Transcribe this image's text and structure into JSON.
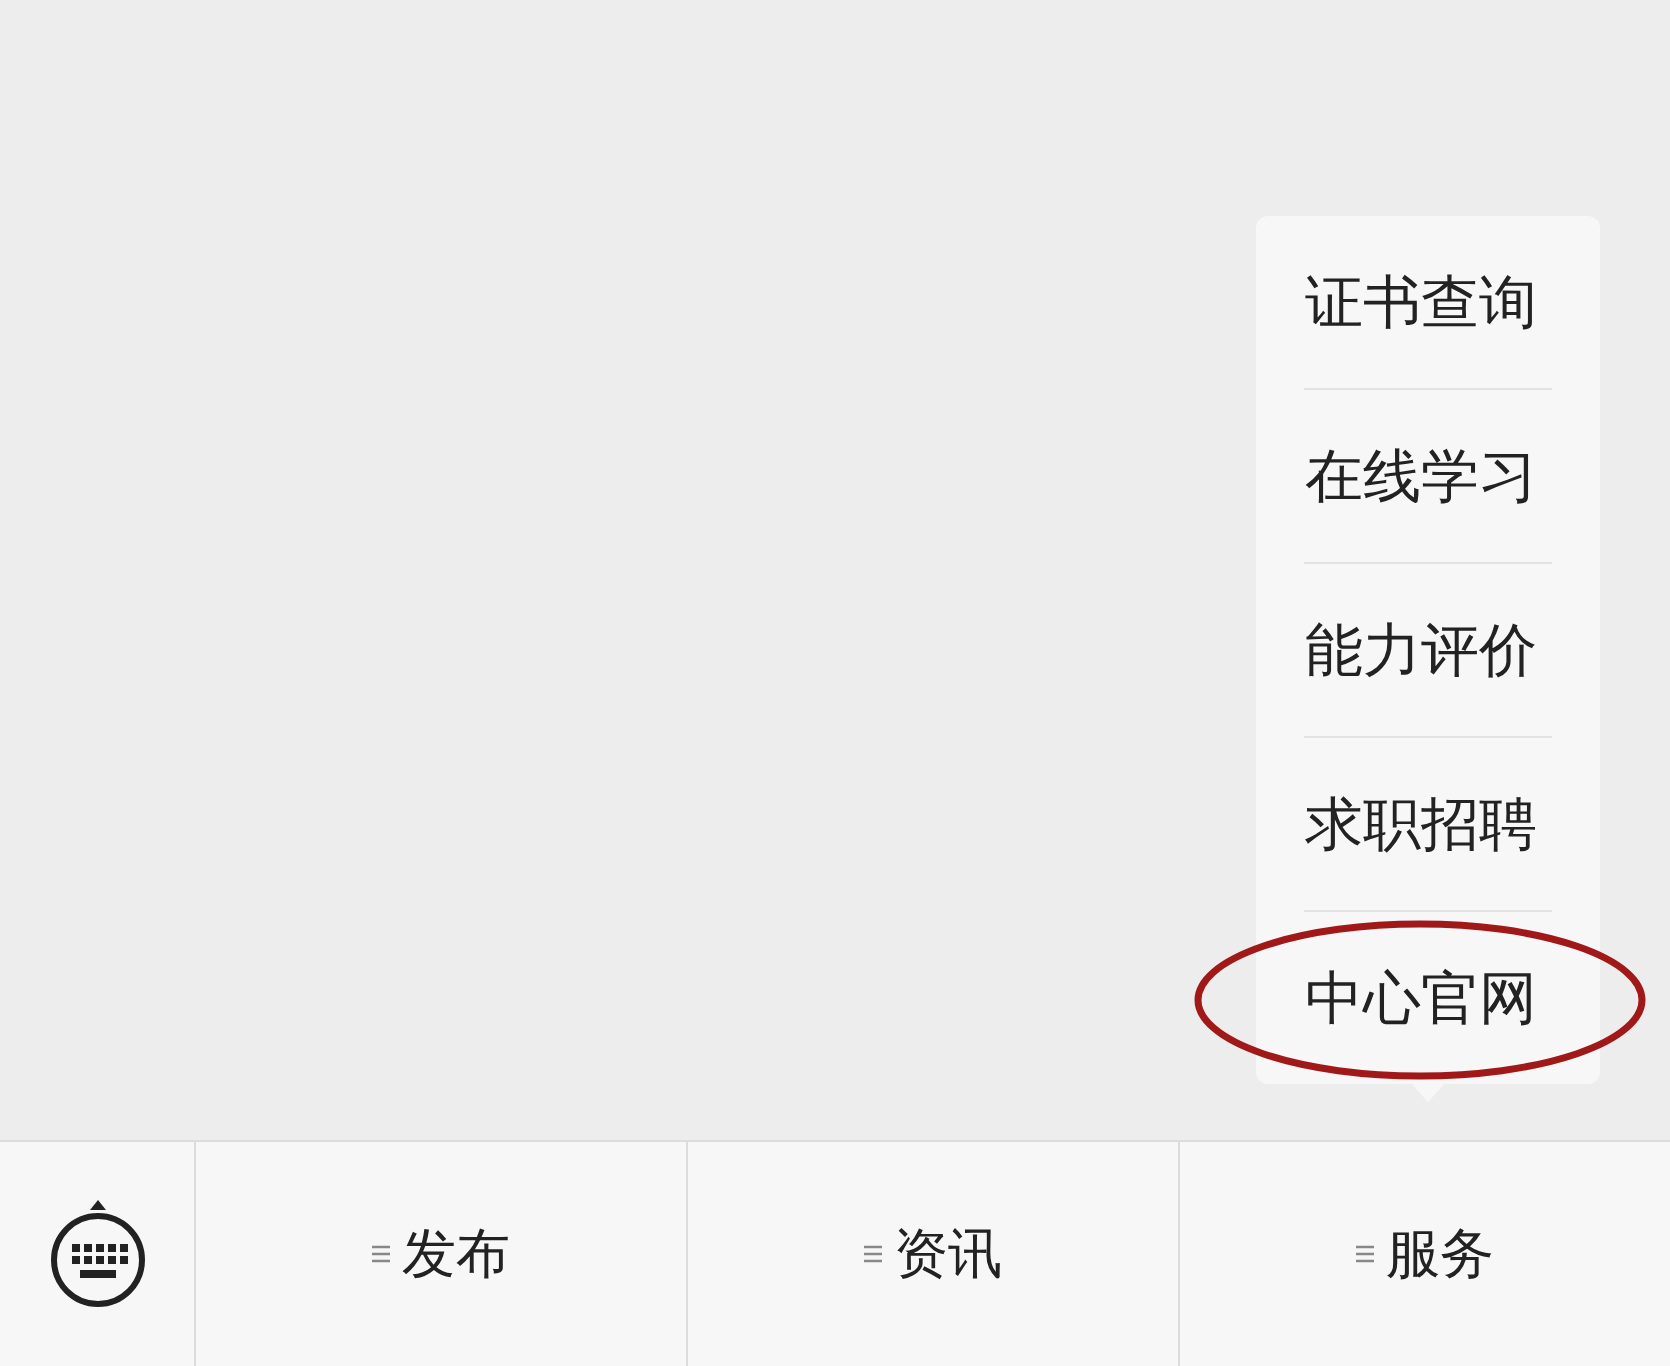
{
  "menu_bar": {
    "items": [
      {
        "label": "发布"
      },
      {
        "label": "资讯"
      },
      {
        "label": "服务",
        "submenu": [
          {
            "label": "证书查询",
            "circled": false
          },
          {
            "label": "在线学习",
            "circled": false
          },
          {
            "label": "能力评价",
            "circled": false
          },
          {
            "label": "求职招聘",
            "circled": false
          },
          {
            "label": "中心官网",
            "circled": true
          }
        ]
      }
    ]
  }
}
